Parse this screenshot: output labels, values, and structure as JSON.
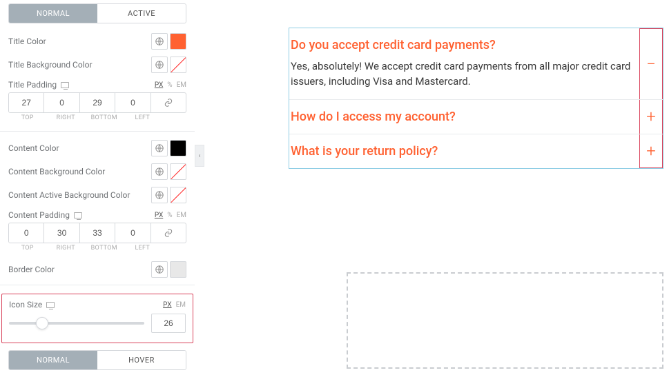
{
  "tabs1": {
    "normal": "NORMAL",
    "active": "ACTIVE"
  },
  "tabs2": {
    "normal": "NORMAL",
    "hover": "HOVER"
  },
  "labels": {
    "titleColor": "Title Color",
    "titleBg": "Title Background Color",
    "titlePad": "Title Padding",
    "contentColor": "Content Color",
    "contentBg": "Content Background Color",
    "contentActiveBg": "Content Active Background Color",
    "contentPad": "Content Padding",
    "borderColor": "Border Color",
    "iconSize": "Icon Size"
  },
  "units": {
    "px": "PX",
    "pct": "%",
    "em": "EM"
  },
  "padLabels": {
    "top": "TOP",
    "right": "RIGHT",
    "bottom": "BOTTOM",
    "left": "LEFT"
  },
  "titlePad": {
    "top": "27",
    "right": "0",
    "bottom": "29",
    "left": "0"
  },
  "contentPad": {
    "top": "0",
    "right": "30",
    "bottom": "33",
    "left": "0"
  },
  "iconSize": "26",
  "colors": {
    "orange": "#ff6131",
    "black": "#000000",
    "gray": "#e8e8e8"
  },
  "faq": {
    "items": [
      {
        "q": "Do you accept credit card payments?",
        "a": "Yes, absolutely! We accept credit card payments from all major credit card issuers, including Visa and Mastercard.",
        "icon": "−",
        "open": true
      },
      {
        "q": "How do I access my account?",
        "icon": "+",
        "open": false
      },
      {
        "q": "What is your return policy?",
        "icon": "+",
        "open": false
      }
    ]
  }
}
